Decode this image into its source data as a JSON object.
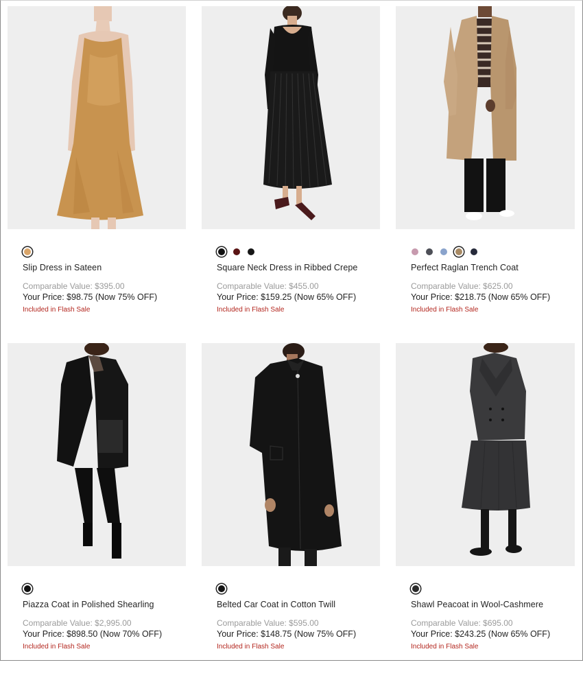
{
  "products": [
    {
      "name": "Slip Dress in Sateen",
      "image": "model-slip-dress-camel",
      "swatches": [
        "#d9a56a"
      ],
      "selected_swatch": 0,
      "comparable": "Comparable Value: $395.00",
      "price": "Your Price: $98.75 (Now 75% OFF)",
      "flash": "Included in Flash Sale"
    },
    {
      "name": "Square Neck Dress in Ribbed Crepe",
      "image": "model-black-pleated-dress",
      "swatches": [
        "#111111",
        "#5a1414",
        "#161616"
      ],
      "selected_swatch": 0,
      "comparable": "Comparable Value: $455.00",
      "price": "Your Price: $159.25 (Now 65% OFF)",
      "flash": "Included in Flash Sale"
    },
    {
      "name": "Perfect Raglan Trench Coat",
      "image": "model-tan-trench-coat",
      "swatches": [
        "#c79aae",
        "#4d4f57",
        "#8aa3cc",
        "#a88a64",
        "#262a3a"
      ],
      "selected_swatch": 3,
      "comparable": "Comparable Value: $625.00",
      "price": "Your Price: $218.75 (Now 65% OFF)",
      "flash": "Included in Flash Sale"
    },
    {
      "name": "Piazza Coat in Polished Shearling",
      "image": "model-black-shearling-coat",
      "swatches": [
        "#111111"
      ],
      "selected_swatch": 0,
      "comparable": "Comparable Value: $2,995.00",
      "price": "Your Price: $898.50 (Now 70% OFF)",
      "flash": "Included in Flash Sale"
    },
    {
      "name": "Belted Car Coat in Cotton Twill",
      "image": "model-black-car-coat",
      "swatches": [
        "#151515"
      ],
      "selected_swatch": 0,
      "comparable": "Comparable Value: $595.00",
      "price": "Your Price: $148.75 (Now 75% OFF)",
      "flash": "Included in Flash Sale"
    },
    {
      "name": "Shawl Peacoat in Wool-Cashmere",
      "image": "model-charcoal-peacoat",
      "swatches": [
        "#2b2b2b"
      ],
      "selected_swatch": 0,
      "comparable": "Comparable Value: $695.00",
      "price": "Your Price: $243.25 (Now 65% OFF)",
      "flash": "Included in Flash Sale"
    }
  ],
  "colors": {
    "image_bg": "#eeeeee",
    "comparable_text": "#9a9a9a",
    "flash_text": "#b3261e"
  }
}
